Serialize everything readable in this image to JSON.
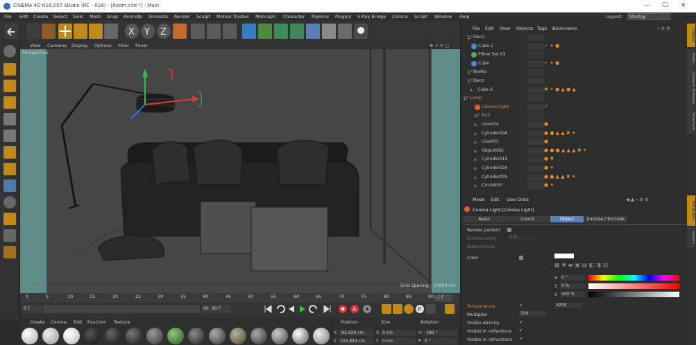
{
  "window": {
    "title": "CINEMA 4D R18.057 Studio (RC - R18) - [Room.c4d *] - Main",
    "controls": [
      "—",
      "☐",
      "✕"
    ]
  },
  "menubar": {
    "items": [
      "File",
      "Edit",
      "Create",
      "Select",
      "Tools",
      "Mesh",
      "Snap",
      "Animate",
      "Simulate",
      "Render",
      "Sculpt",
      "Motion Tracker",
      "MoGraph",
      "Character",
      "Pipeline",
      "Plugins",
      "V-Ray Bridge",
      "Corona",
      "Script",
      "Window",
      "Help"
    ],
    "layout_label": "Layout:",
    "layout_value": "Startup"
  },
  "viewport": {
    "menu": [
      "View",
      "Cameras",
      "Display",
      "Options",
      "Filter",
      "Panel"
    ],
    "label": "Perspective",
    "grid_spacing": "Grid Spacing : 10000 cm"
  },
  "timeline": {
    "ticks": [
      "1",
      "5",
      "10",
      "15",
      "20",
      "25",
      "30",
      "35",
      "40",
      "45",
      "50",
      "55",
      "60",
      "65",
      "70",
      "75",
      "80",
      "85",
      "90"
    ],
    "current_frame": "0 F",
    "start_field": "0 F",
    "end_field": "90 F",
    "end_field2": "90 F",
    "frame_display": "-1 F"
  },
  "material_manager": {
    "menu": [
      "Create",
      "Corona",
      "Edit",
      "Function",
      "Texture"
    ]
  },
  "coordinates": {
    "headers": [
      "Position",
      "Size",
      "Rotation"
    ],
    "rows": [
      {
        "axis": "X",
        "pos": "-92.929 cm",
        "size_axis": "X",
        "size": "0 cm",
        "rot_axis": "H",
        "rot": "-180 °"
      },
      {
        "axis": "Y",
        "pos": "104.843 cm",
        "size_axis": "Y",
        "size": "0 cm",
        "rot_axis": "P",
        "rot": "0 °"
      }
    ]
  },
  "object_manager": {
    "menu": [
      "File",
      "Edit",
      "View",
      "Objects",
      "Tags",
      "Bookmarks"
    ],
    "objects": [
      {
        "name": "Deco",
        "type": "null"
      },
      {
        "name": "Cube.1",
        "type": "cube"
      },
      {
        "name": "Pillow Set 03",
        "type": "group"
      },
      {
        "name": "Cube",
        "type": "cube"
      },
      {
        "name": "Books",
        "type": "null"
      },
      {
        "name": "Deco",
        "type": "null"
      },
      {
        "name": "Cube.6",
        "type": "poly"
      },
      {
        "name": "Lamp",
        "type": "null",
        "highlight": true
      },
      {
        "name": "Corona Light",
        "type": "light",
        "highlight": true
      },
      {
        "name": "Null",
        "type": "null",
        "highlight": true
      },
      {
        "name": "Line004",
        "type": "poly"
      },
      {
        "name": "Cylinder006",
        "type": "poly"
      },
      {
        "name": "Line003",
        "type": "poly"
      },
      {
        "name": "Object062",
        "type": "poly"
      },
      {
        "name": "Cylinder015",
        "type": "poly"
      },
      {
        "name": "Cylinder020",
        "type": "poly"
      },
      {
        "name": "Cylinder005",
        "type": "poly"
      },
      {
        "name": "Circle003",
        "type": "poly"
      }
    ]
  },
  "attribute_manager": {
    "menu": [
      "Mode",
      "Edit",
      "User Data"
    ],
    "title": "Corona Light [Corona Light]",
    "tabs": [
      "Basic",
      "Coord.",
      "Object",
      "Include / Exclude"
    ],
    "active_tab": "Object",
    "props": {
      "render_perfect": "Render perfect",
      "directionality": "Directionality",
      "directionality_value": "0 %",
      "bidirectional": "Bidirectional",
      "color": "Color",
      "color_values": {
        "h_label": "H",
        "h": "0 °",
        "s_label": "S",
        "s": "0 %",
        "v_label": "V",
        "v": "100 %"
      },
      "temperature": "Temperature",
      "temperature_value": "3200",
      "multiplier": "Multiplier",
      "multiplier_value": "100",
      "visible_directly": "Visible directly",
      "visible_reflections": "Visible in reflections",
      "visible_refractions": "Visible in refractions"
    }
  },
  "right_tabs": [
    "Objects",
    "Takes",
    "Content Browser",
    "Structure",
    "Attributes",
    "Layers"
  ],
  "colors": {
    "accent_blue": "#5a7fb5",
    "highlight_orange": "#e28a2a",
    "teal_backdrop": "#5e8c86"
  }
}
